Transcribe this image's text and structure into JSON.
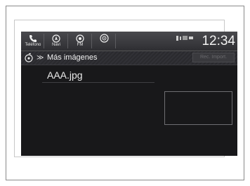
{
  "status_bar": {
    "apps": [
      {
        "name": "phone",
        "label": "Teléfono",
        "icon": "phone-icon"
      },
      {
        "name": "navi",
        "label": "Navi",
        "icon": "navigation-icon"
      },
      {
        "name": "fm",
        "label": "FM",
        "icon": "radio-icon"
      },
      {
        "name": "audio",
        "label": "",
        "icon": "audio-source-icon"
      }
    ],
    "clock": "12:34"
  },
  "title_bar": {
    "title": "Más imágenes",
    "back_icon": "back-icon",
    "chevron": "≫",
    "action_label": "Rec. Import."
  },
  "list": {
    "items": [
      {
        "filename": "AAA.jpg"
      }
    ]
  },
  "colors": {
    "screen_bg": "#18181a",
    "text": "#eaeaea",
    "statusbar": "#3a3a3e"
  }
}
